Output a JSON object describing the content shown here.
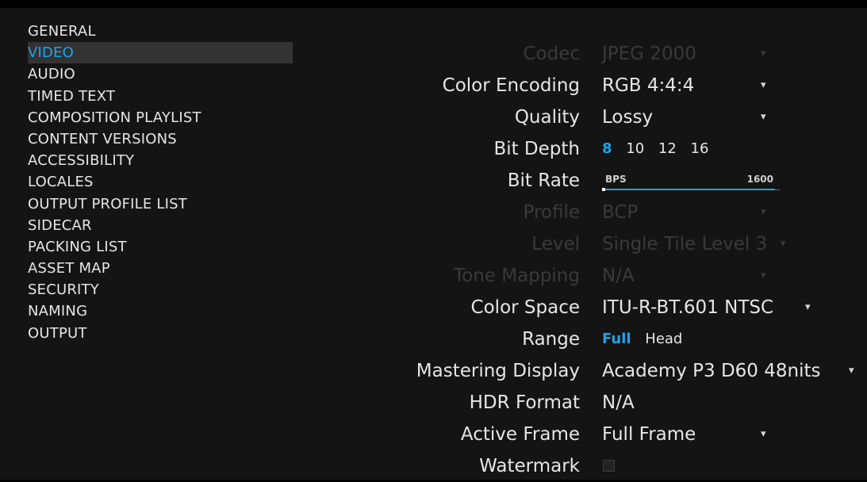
{
  "sidebar": {
    "items": [
      {
        "label": "GENERAL",
        "active": false
      },
      {
        "label": "VIDEO",
        "active": true
      },
      {
        "label": "AUDIO",
        "active": false
      },
      {
        "label": "TIMED TEXT",
        "active": false
      },
      {
        "label": "COMPOSITION PLAYLIST",
        "active": false
      },
      {
        "label": "CONTENT VERSIONS",
        "active": false
      },
      {
        "label": "ACCESSIBILITY",
        "active": false
      },
      {
        "label": "LOCALES",
        "active": false
      },
      {
        "label": "OUTPUT PROFILE LIST",
        "active": false
      },
      {
        "label": "SIDECAR",
        "active": false
      },
      {
        "label": "PACKING LIST",
        "active": false
      },
      {
        "label": "ASSET MAP",
        "active": false
      },
      {
        "label": "SECURITY",
        "active": false
      },
      {
        "label": "NAMING",
        "active": false
      },
      {
        "label": "OUTPUT",
        "active": false
      }
    ]
  },
  "video": {
    "codec": {
      "label": "Codec",
      "value": "JPEG 2000",
      "enabled": false
    },
    "color_encoding": {
      "label": "Color Encoding",
      "value": "RGB 4:4:4"
    },
    "quality": {
      "label": "Quality",
      "value": "Lossy"
    },
    "bit_depth": {
      "label": "Bit Depth",
      "options": [
        "8",
        "10",
        "12",
        "16"
      ],
      "selected": "8"
    },
    "bit_rate": {
      "label": "Bit Rate",
      "unit": "BPS",
      "max": "1600"
    },
    "profile": {
      "label": "Profile",
      "value": "BCP",
      "enabled": false
    },
    "level": {
      "label": "Level",
      "value": "Single Tile Level 3",
      "enabled": false
    },
    "tone_mapping": {
      "label": "Tone Mapping",
      "value": "N/A",
      "enabled": false
    },
    "color_space": {
      "label": "Color Space",
      "value": "ITU-R-BT.601 NTSC"
    },
    "range": {
      "label": "Range",
      "options": [
        "Full",
        "Head"
      ],
      "selected": "Full"
    },
    "mastering_display": {
      "label": "Mastering Display",
      "value": "Academy P3 D60 48nits"
    },
    "hdr_format": {
      "label": "HDR Format",
      "value": "N/A"
    },
    "active_frame": {
      "label": "Active Frame",
      "value": "Full Frame"
    },
    "watermark": {
      "label": "Watermark",
      "checked": false
    }
  },
  "colors": {
    "accent": "#1fa3e6",
    "background": "#141414",
    "disabled": "#3a3a3a"
  },
  "icons": {
    "dropdown": "caret-down-icon"
  }
}
